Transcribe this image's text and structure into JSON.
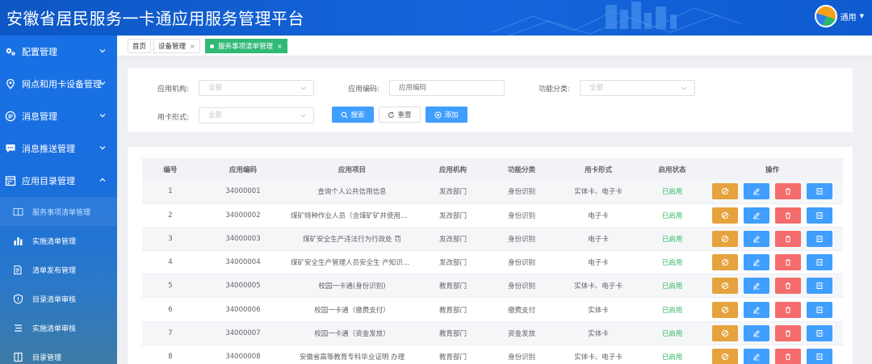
{
  "header": {
    "title": "安徽省居民服务一卡通应用服务管理平台",
    "user": "通用"
  },
  "sidebar": {
    "items": [
      {
        "label": "配置管理",
        "icon": "gears-icon",
        "expanded": false
      },
      {
        "label": "网点和用卡设备管理",
        "icon": "location-pin-icon",
        "expanded": false
      },
      {
        "label": "消息管理",
        "icon": "message-list-icon",
        "expanded": false
      },
      {
        "label": "消息推送管理",
        "icon": "chat-bubble-icon",
        "expanded": false
      },
      {
        "label": "应用目录管理",
        "icon": "calendar-grid-icon",
        "expanded": true
      }
    ],
    "subitems": [
      {
        "label": "服务事项清单管理",
        "icon": "book-open-icon",
        "active": true
      },
      {
        "label": "实施清单管理",
        "icon": "bar-chart-icon",
        "active": false
      },
      {
        "label": "清单发布管理",
        "icon": "document-edit-icon",
        "active": false
      },
      {
        "label": "目录清单审核",
        "icon": "shield-icon",
        "active": false
      },
      {
        "label": "实施清单审核",
        "icon": "list-icon",
        "active": false
      },
      {
        "label": "目录管理",
        "icon": "book-icon",
        "active": false
      }
    ]
  },
  "tabs": [
    {
      "label": "首页",
      "closable": false,
      "active": false
    },
    {
      "label": "设备管理",
      "closable": true,
      "active": false
    },
    {
      "label": "服务事项清单管理",
      "closable": true,
      "active": true
    }
  ],
  "tab_close_glyph": "×",
  "filter": {
    "org_label": "应用机构:",
    "org_value": "全部",
    "code_label": "应用编码:",
    "code_placeholder": "应用编码",
    "category_label": "功能分类:",
    "category_value": "全部",
    "card_label": "用卡形式:",
    "card_value": "全部",
    "search_label": "搜索",
    "reset_label": "重置",
    "add_label": "添加"
  },
  "table": {
    "columns": [
      "编号",
      "应用编码",
      "应用项目",
      "应用机构",
      "功能分类",
      "用卡形式",
      "启用状态",
      "操作"
    ],
    "rows": [
      {
        "no": "1",
        "code": "34000001",
        "project": "查询个人公共信用信息",
        "org": "发改部门",
        "category": "身份识别",
        "card": "实体卡、电子卡",
        "status": "已启用"
      },
      {
        "no": "2",
        "code": "34000002",
        "project": "煤矿特种作业人员（含煤矿矿井使用的特种设备作业人员）",
        "org": "发改部门",
        "category": "身份识别",
        "card": "电子卡",
        "status": "已启用"
      },
      {
        "no": "3",
        "code": "34000003",
        "project": "煤矿安全生产违法行为行政处 罚",
        "org": "发改部门",
        "category": "身份识别",
        "card": "电子卡",
        "status": "已启用"
      },
      {
        "no": "4",
        "code": "34000004",
        "project": "煤矿安全生产管理人员安全生 产知识和管理能力考核",
        "org": "发改部门",
        "category": "身份识别",
        "card": "电子卡",
        "status": "已启用"
      },
      {
        "no": "5",
        "code": "34000005",
        "project": "校园一卡通(身份识别)",
        "org": "教育部门",
        "category": "身份识别",
        "card": "实体卡、电子卡",
        "status": "已启用"
      },
      {
        "no": "6",
        "code": "34000006",
        "project": "校园一卡通（缴费支付）",
        "org": "教育部门",
        "category": "缴费支付",
        "card": "实体卡",
        "status": "已启用"
      },
      {
        "no": "7",
        "code": "34000007",
        "project": "校园一卡通（资金发放）",
        "org": "教育部门",
        "category": "资金发放",
        "card": "实体卡",
        "status": "已启用"
      },
      {
        "no": "8",
        "code": "34000008",
        "project": "安徽省高等教育专科毕业证明 办理",
        "org": "教育部门",
        "category": "身份识别",
        "card": "实体卡、电子卡",
        "status": "已启用"
      }
    ]
  },
  "colors": {
    "brand": "#1465dc",
    "accent": "#409eff",
    "active_tab": "#31b977",
    "enabled": "#32b765",
    "warning": "#e6a23c",
    "danger": "#f56c6c"
  }
}
